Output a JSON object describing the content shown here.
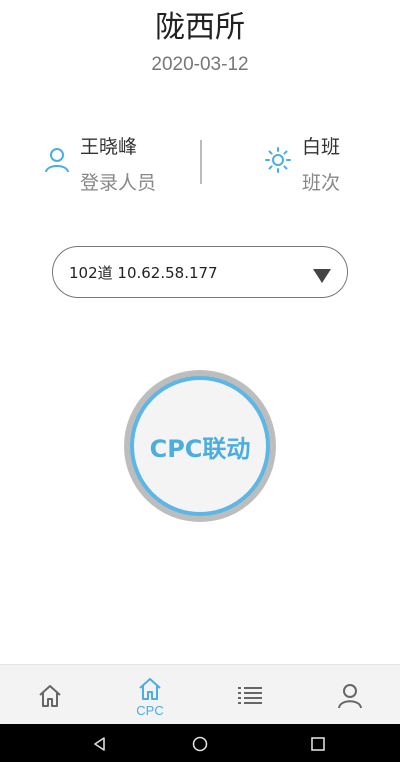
{
  "header": {
    "title": "陇西所",
    "date": "2020-03-12"
  },
  "user": {
    "name": "王晓峰",
    "role_label": "登录人员",
    "icon": "person-icon"
  },
  "shift": {
    "name": "白班",
    "label": "班次",
    "icon": "sun-icon"
  },
  "lane_select": {
    "value": "102道  10.62.58.177",
    "icon": "dropdown-caret-icon"
  },
  "action": {
    "label": "CPC联动"
  },
  "tabbar": {
    "tabs": [
      {
        "icon": "home-icon",
        "label": ""
      },
      {
        "icon": "home-icon",
        "label": "CPC",
        "active": true
      },
      {
        "icon": "list-icon",
        "label": ""
      },
      {
        "icon": "person-icon",
        "label": ""
      }
    ]
  },
  "system_nav": [
    "back-icon",
    "home-circle-icon",
    "recents-icon"
  ],
  "colors": {
    "accent": "#4aaee0",
    "tabbar_bg": "#f3f3f3"
  }
}
